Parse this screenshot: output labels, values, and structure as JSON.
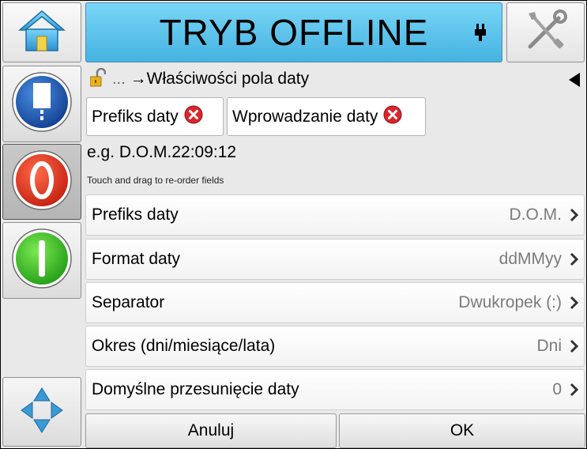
{
  "header": {
    "title": "TRYB OFFLINE"
  },
  "breadcrumb": {
    "ellipsis": "...",
    "text": "→Właściwości pola daty"
  },
  "chips": [
    {
      "label": "Prefiks daty"
    },
    {
      "label": "Wprowadzanie daty"
    }
  ],
  "example": "e.g. D.O.M.22:09:12",
  "hint": "Touch and drag to re-order fields",
  "rows": [
    {
      "label": "Prefiks daty",
      "value": "D.O.M."
    },
    {
      "label": "Format daty",
      "value": "ddMMyy"
    },
    {
      "label": "Separator",
      "value": "Dwukropek (:)"
    },
    {
      "label": "Okres (dni/miesiące/lata)",
      "value": "Dni"
    },
    {
      "label": "Domyślne przesunięcie daty",
      "value": "0"
    }
  ],
  "footer": {
    "cancel_label": "Anuluj",
    "ok_label": "OK"
  },
  "icons": {
    "home": "home-icon",
    "plug": "plug-icon",
    "tools": "tools-icon",
    "info": "info-icon",
    "stop": "stop-icon",
    "start": "start-icon",
    "navigate": "navigate-arrows-icon",
    "lock": "unlock-icon",
    "back": "back-triangle-icon",
    "remove": "remove-x-icon",
    "chevron": "chevron-right-icon"
  },
  "colors": {
    "title_bar": "#45b2e1",
    "stop_red": "#e8311c",
    "start_green": "#3cc12a",
    "info_blue": "#1c5fc0",
    "remove_red": "#d9262c",
    "value_gray": "#7b7b7b"
  }
}
